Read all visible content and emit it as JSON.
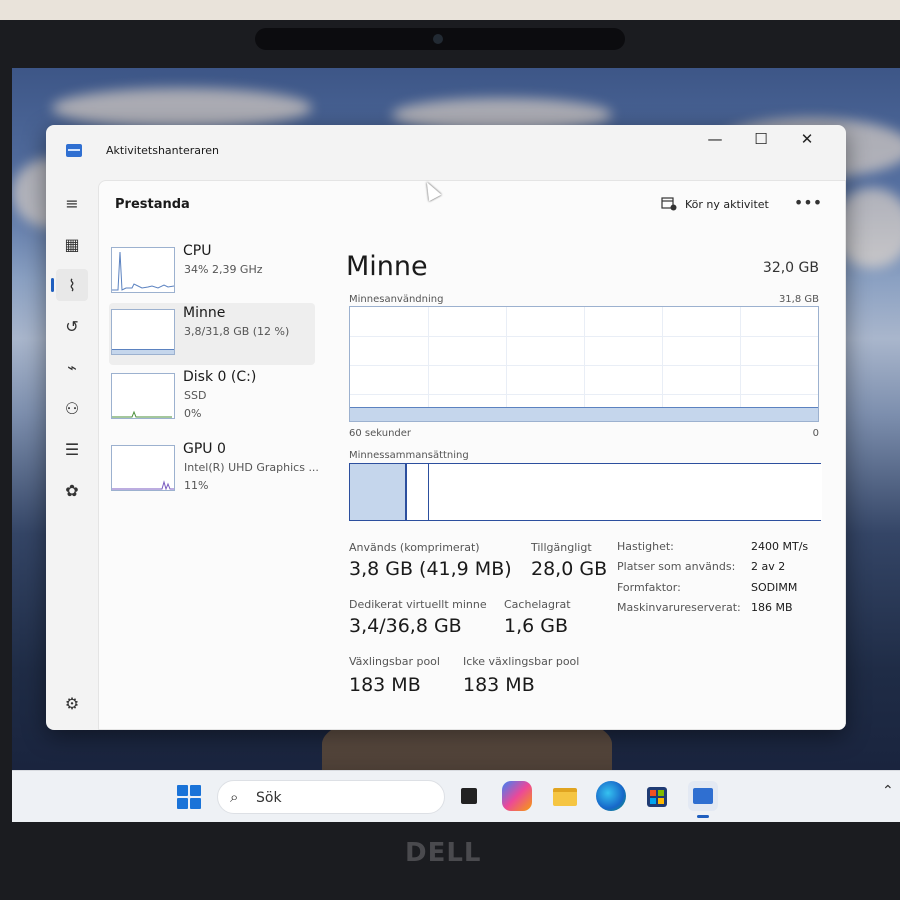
{
  "window": {
    "title": "Aktivitetshanteraren",
    "controls": {
      "minimize": "—",
      "maximize": "☐",
      "close": "✕"
    }
  },
  "nav": {
    "items": [
      {
        "name": "menu-icon",
        "glyph": "≡"
      },
      {
        "name": "processes-icon",
        "glyph": "▦"
      },
      {
        "name": "performance-icon",
        "glyph": "⌇"
      },
      {
        "name": "app-history-icon",
        "glyph": "↺"
      },
      {
        "name": "startup-icon",
        "glyph": "⌁"
      },
      {
        "name": "users-icon",
        "glyph": "⚇"
      },
      {
        "name": "details-icon",
        "glyph": "☰"
      },
      {
        "name": "services-icon",
        "glyph": "✿"
      }
    ],
    "settings_glyph": "⚙"
  },
  "header": {
    "title": "Prestanda",
    "run_task_label": "Kör ny aktivitet",
    "more_label": "•••"
  },
  "devices": [
    {
      "name": "CPU",
      "line1": "34%  2,39 GHz",
      "line2": ""
    },
    {
      "name": "Minne",
      "line1": "3,8/31,8 GB (12 %)",
      "line2": ""
    },
    {
      "name": "Disk 0 (C:)",
      "line1": "SSD",
      "line2": "0%"
    },
    {
      "name": "GPU 0",
      "line1": "Intel(R) UHD Graphics ...",
      "line2": "11%"
    }
  ],
  "memory": {
    "title": "Minne",
    "total": "32,0 GB",
    "usage_label": "Minnesanvändning",
    "usage_max": "31,8 GB",
    "usage_fraction": 0.12,
    "time_label": "60 sekunder",
    "time_min": "0",
    "composition_label": "Minnessammansättning",
    "stats": [
      {
        "label": "Används (komprimerat)",
        "value": "3,8 GB (41,9 MB)"
      },
      {
        "label": "Tillgängligt",
        "value": "28,0 GB"
      },
      {
        "label": "Dedikerat virtuellt minne",
        "value": "3,4/36,8 GB"
      },
      {
        "label": "Cachelagrat",
        "value": "1,6 GB"
      },
      {
        "label": "Växlingsbar pool",
        "value": "183 MB"
      },
      {
        "label": "Icke växlingsbar pool",
        "value": "183 MB"
      }
    ],
    "details": [
      {
        "label": "Hastighet:",
        "value": "2400 MT/s"
      },
      {
        "label": "Platser som används:",
        "value": "2 av 2"
      },
      {
        "label": "Formfaktor:",
        "value": "SODIMM"
      },
      {
        "label": "Maskinvarureserverat:",
        "value": "186 MB"
      }
    ]
  },
  "taskbar": {
    "search_placeholder": "Sök"
  },
  "brand": "DELL",
  "colors": {
    "accent": "#1f5fbf",
    "graph_fill": "#c5d6ec",
    "graph_border": "#9cb1cf"
  }
}
